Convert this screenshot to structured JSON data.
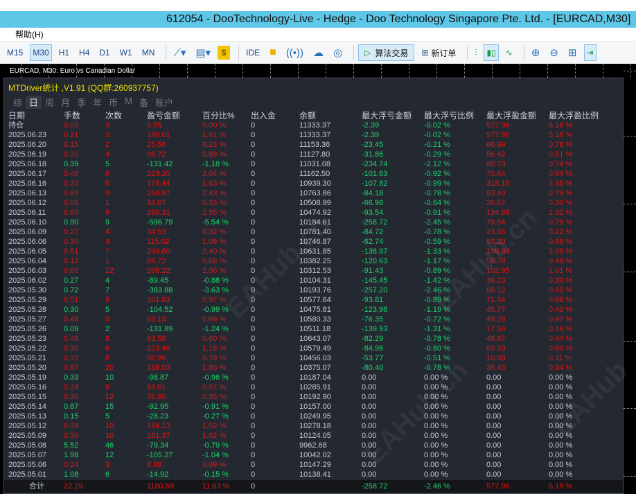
{
  "window": {
    "title": "612054 - DooTechnology-Live - Hedge - Doo Technology Singapore Pte. Ltd. - [EURCAD,M30]"
  },
  "menu": {
    "help": "帮助(H)"
  },
  "toolbar": {
    "timeframes": [
      "M15",
      "M30",
      "H1",
      "H4",
      "D1",
      "W1",
      "MN"
    ],
    "active_timeframe": "M30",
    "ide": "IDE",
    "algo_trading": "算法交易",
    "new_order": "新订单"
  },
  "chart": {
    "label": "EURCAD, M30:  Euro vs Canadian Dollar"
  },
  "panel": {
    "title": "MTDriver统计 ,V1.91 (QQ群:260937757)",
    "tabs": [
      "综",
      "日",
      "周",
      "月",
      "季",
      "年",
      "币",
      "M",
      "备",
      "账户"
    ],
    "active_tab": "日"
  },
  "colors": {
    "profit": "#e01515",
    "loss": "#1fd46e",
    "neutral": "#c6cbd6",
    "title": "#f0e000"
  },
  "table": {
    "headers": [
      "日期",
      "手数",
      "次数",
      "盈亏金额",
      "百分比%",
      "出入金",
      "余额",
      "最大浮亏金额",
      "最大浮亏比例",
      "最大浮盈金额",
      "最大浮盈比例"
    ],
    "rows": [
      [
        "持仓",
        "0.09",
        "3",
        "0.55",
        "0.00 %",
        "0",
        "11333.37",
        "-2.39",
        "-0.02 %",
        "577.96",
        "5.18 %",
        "r"
      ],
      [
        "2025.06.23",
        "0.21",
        "3",
        "180.01",
        "1.61 %",
        "0",
        "11333.37",
        "-2.39",
        "-0.02 %",
        "577.96",
        "5.18 %",
        "r"
      ],
      [
        "2025.06.20",
        "0.15",
        "2",
        "25.56",
        "0.23 %",
        "0",
        "11153.36",
        "-23.45",
        "-0.21 %",
        "86.99",
        "0.78 %",
        "r"
      ],
      [
        "2025.06.19",
        "0.30",
        "4",
        "96.72",
        "0.88 %",
        "0",
        "11127.80",
        "-31.86",
        "-0.29 %",
        "56.42",
        "0.51 %",
        "r"
      ],
      [
        "2025.06.18",
        "0.39",
        "5",
        "-131.42",
        "-1.18 %",
        "0",
        "11031.08",
        "-234.74",
        "-2.12 %",
        "80.73",
        "0.74 %",
        "g"
      ],
      [
        "2025.06.17",
        "0.48",
        "6",
        "223.20",
        "2.04 %",
        "0",
        "11162.50",
        "-101.63",
        "-0.92 %",
        "70.64",
        "0.64 %",
        "r"
      ],
      [
        "2025.06.16",
        "0.33",
        "5",
        "175.44",
        "1.63 %",
        "0",
        "10939.30",
        "-107.82",
        "-0.99 %",
        "318.15",
        "2.95 %",
        "r"
      ],
      [
        "2025.06.13",
        "0.69",
        "9",
        "254.87",
        "2.43 %",
        "0",
        "10763.86",
        "-84.18",
        "-0.78 %",
        "83.40",
        "0.79 %",
        "r"
      ],
      [
        "2025.06.12",
        "0.06",
        "1",
        "34.07",
        "0.33 %",
        "0",
        "10508.99",
        "-66.96",
        "-0.64 %",
        "20.57",
        "0.20 %",
        "r"
      ],
      [
        "2025.06.11",
        "0.69",
        "9",
        "290.31",
        "2.85 %",
        "0",
        "10474.92",
        "-93.54",
        "-0.91 %",
        "134.88",
        "1.32 %",
        "r"
      ],
      [
        "2025.06.10",
        "0.90",
        "9",
        "-596.79",
        "-5.54 %",
        "0",
        "10184.61",
        "-258.72",
        "-2.45 %",
        "79.54",
        "0.79 %",
        "g"
      ],
      [
        "2025.06.09",
        "0.27",
        "4",
        "34.53",
        "0.32 %",
        "0",
        "10781.40",
        "-84.72",
        "-0.78 %",
        "23.66",
        "0.22 %",
        "r"
      ],
      [
        "2025.06.06",
        "0.30",
        "4",
        "115.02",
        "1.08 %",
        "0",
        "10746.87",
        "-62.74",
        "-0.59 %",
        "93.20",
        "0.88 %",
        "r"
      ],
      [
        "2025.06.05",
        "0.51",
        "7",
        "249.60",
        "2.40 %",
        "0",
        "10631.85",
        "-138.97",
        "-1.33 %",
        "109.84",
        "1.05 %",
        "r"
      ],
      [
        "2025.06.04",
        "0.12",
        "1",
        "69.72",
        "0.68 %",
        "0",
        "10382.25",
        "-120.63",
        "-1.17 %",
        "50.78",
        "0.49 %",
        "r"
      ],
      [
        "2025.06.03",
        "0.66",
        "12",
        "208.22",
        "2.06 %",
        "0",
        "10312.53",
        "-91.43",
        "-0.89 %",
        "102.95",
        "1.01 %",
        "r"
      ],
      [
        "2025.06.02",
        "0.27",
        "4",
        "-89.45",
        "-0.88 %",
        "0",
        "10104.31",
        "-145.45",
        "-1.42 %",
        "39.23",
        "0.39 %",
        "g"
      ],
      [
        "2025.05.30",
        "0.72",
        "7",
        "-383.88",
        "-3.63 %",
        "0",
        "10193.76",
        "-257.20",
        "-2.46 %",
        "68.12",
        "0.65 %",
        "g"
      ],
      [
        "2025.05.29",
        "0.51",
        "8",
        "101.83",
        "0.97 %",
        "0",
        "10577.64",
        "-93.81",
        "-0.89 %",
        "71.34",
        "0.68 %",
        "r"
      ],
      [
        "2025.05.28",
        "0.30",
        "5",
        "-104.52",
        "-0.99 %",
        "0",
        "10475.81",
        "-123.98",
        "-1.19 %",
        "45.77",
        "0.43 %",
        "g"
      ],
      [
        "2025.05.27",
        "0.48",
        "9",
        "69.15",
        "0.66 %",
        "0",
        "10580.33",
        "-76.35",
        "-0.72 %",
        "49.28",
        "0.47 %",
        "r"
      ],
      [
        "2025.05.26",
        "0.09",
        "2",
        "-131.89",
        "-1.24 %",
        "0",
        "10511.18",
        "-139.93",
        "-1.31 %",
        "17.56",
        "0.16 %",
        "g"
      ],
      [
        "2025.05.23",
        "0.48",
        "8",
        "63.58",
        "0.60 %",
        "0",
        "10643.07",
        "-82.29",
        "-0.78 %",
        "46.97",
        "0.44 %",
        "r"
      ],
      [
        "2025.05.22",
        "0.39",
        "6",
        "123.46",
        "1.18 %",
        "0",
        "10579.49",
        "-84.96",
        "-0.80 %",
        "63.33",
        "0.60 %",
        "r"
      ],
      [
        "2025.05.21",
        "0.33",
        "8",
        "80.96",
        "0.78 %",
        "0",
        "10456.03",
        "-53.77",
        "-0.51 %",
        "10.99",
        "0.11 %",
        "r"
      ],
      [
        "2025.05.20",
        "0.87",
        "20",
        "188.03",
        "1.85 %",
        "0",
        "10375.07",
        "-80.40",
        "-0.78 %",
        "35.45",
        "0.34 %",
        "r"
      ],
      [
        "2025.05.19",
        "0.33",
        "10",
        "-98.87",
        "-0.96 %",
        "0",
        "10187.04",
        "0.00",
        "0.00 %",
        "0.00",
        "0.00 %",
        "g"
      ],
      [
        "2025.05.16",
        "0.24",
        "8",
        "93.01",
        "0.91 %",
        "0",
        "10285.91",
        "0.00",
        "0.00 %",
        "0.00",
        "0.00 %",
        "r"
      ],
      [
        "2025.05.15",
        "0.36",
        "12",
        "35.90",
        "0.35 %",
        "0",
        "10192.90",
        "0.00",
        "0.00 %",
        "0.00",
        "0.00 %",
        "r"
      ],
      [
        "2025.05.14",
        "0.87",
        "15",
        "-92.95",
        "-0.91 %",
        "0",
        "10157.00",
        "0.00",
        "0.00 %",
        "0.00",
        "0.00 %",
        "g"
      ],
      [
        "2025.05.13",
        "0.15",
        "5",
        "-28.23",
        "-0.27 %",
        "0",
        "10249.95",
        "0.00",
        "0.00 %",
        "0.00",
        "0.00 %",
        "g"
      ],
      [
        "2025.05.12",
        "0.54",
        "10",
        "154.13",
        "1.52 %",
        "0",
        "10278.18",
        "0.00",
        "0.00 %",
        "0.00",
        "0.00 %",
        "r"
      ],
      [
        "2025.05.09",
        "0.39",
        "10",
        "161.37",
        "1.62 %",
        "0",
        "10124.05",
        "0.00",
        "0.00 %",
        "0.00",
        "0.00 %",
        "r"
      ],
      [
        "2025.05.08",
        "5.52",
        "46",
        "-79.34",
        "-0.79 %",
        "0",
        "9962.68",
        "0.00",
        "0.00 %",
        "0.00",
        "0.00 %",
        "g"
      ],
      [
        "2025.05.07",
        "1.98",
        "12",
        "-105.27",
        "-1.04 %",
        "0",
        "10042.02",
        "0.00",
        "0.00 %",
        "0.00",
        "0.00 %",
        "g"
      ],
      [
        "2025.05.06",
        "0.24",
        "3",
        "8.88",
        "0.09 %",
        "0",
        "10147.29",
        "0.00",
        "0.00 %",
        "0.00",
        "0.00 %",
        "r"
      ],
      [
        "2025.05.01",
        "1.08",
        "6",
        "-14.92",
        "-0.15 %",
        "0",
        "10138.41",
        "0.00",
        "0.00 %",
        "0.00",
        "0.00 %",
        "g"
      ]
    ],
    "total": [
      "合计",
      "22.29",
      "",
      "1180.59",
      "11.63 %",
      "0",
      "",
      "-258.72",
      "-2.46 %",
      "577.96",
      "5.18 %",
      "r"
    ]
  }
}
